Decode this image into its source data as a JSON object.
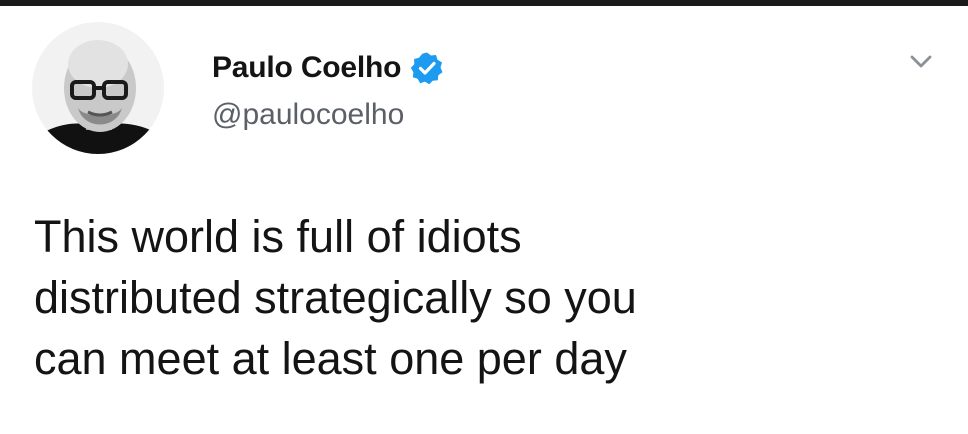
{
  "tweet": {
    "author": {
      "display_name": "Paulo Coelho",
      "handle": "@paulocoelho",
      "verified": true,
      "avatar_icon": "avatar-photo",
      "verified_icon": "verified-badge-icon"
    },
    "menu_icon": "chevron-down-icon",
    "text_lines": [
      "This world is full of idiots",
      "distributed strategically so you",
      "can meet at least one per day"
    ]
  },
  "colors": {
    "text": "#141414",
    "secondary_text": "#5b6066",
    "verified_badge": "#1d9bf0",
    "background": "#ffffff"
  }
}
